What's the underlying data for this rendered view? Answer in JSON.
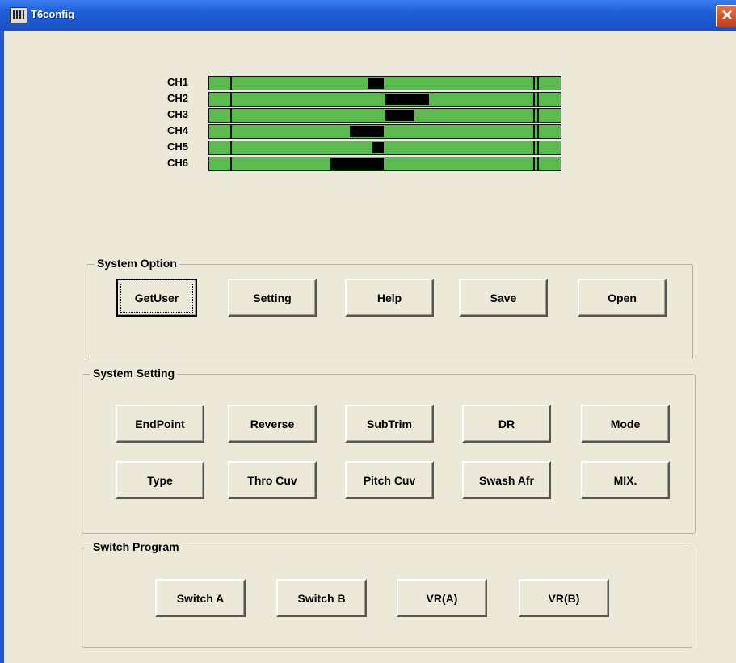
{
  "window": {
    "title": "T6config",
    "close_label": "✕"
  },
  "channels": [
    {
      "label": "CH1"
    },
    {
      "label": "CH2"
    },
    {
      "label": "CH3"
    },
    {
      "label": "CH4"
    },
    {
      "label": "CH5"
    },
    {
      "label": "CH6"
    }
  ],
  "system_option": {
    "title": "System Option",
    "buttons": [
      "GetUser",
      "Setting",
      "Help",
      "Save",
      "Open"
    ]
  },
  "system_setting": {
    "title": "System Setting",
    "row1": [
      "EndPoint",
      "Reverse",
      "SubTrim",
      "DR",
      "Mode"
    ],
    "row2": [
      "Type",
      "Thro Cuv",
      "Pitch Cuv",
      "Swash Afr",
      "MIX."
    ]
  },
  "switch_program": {
    "title": "Switch Program",
    "buttons": [
      "Switch A",
      "Switch B",
      "VR(A)",
      "VR(B)"
    ]
  },
  "colors": {
    "bar": "#5cbb4f",
    "indicator": "#000000",
    "face": "#ece9d8"
  }
}
